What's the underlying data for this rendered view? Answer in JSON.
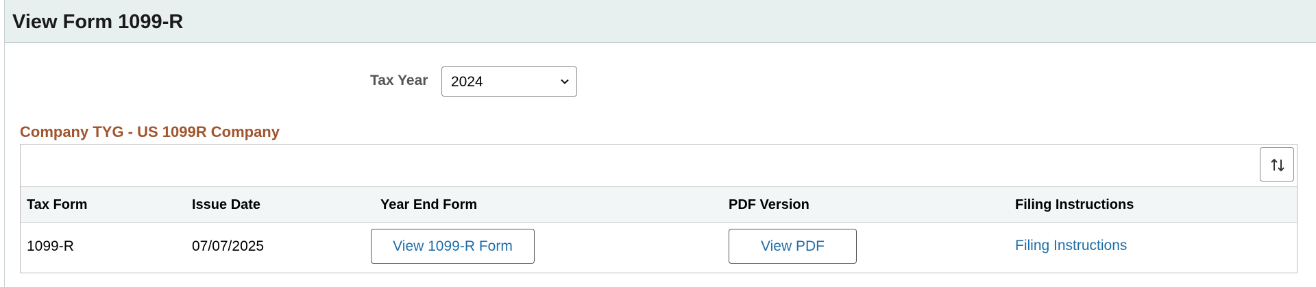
{
  "header": {
    "title": "View Form 1099-R"
  },
  "filters": {
    "tax_year_label": "Tax Year",
    "tax_year_selected": "2024"
  },
  "company": {
    "title": "Company TYG - US 1099R Company"
  },
  "grid": {
    "columns": [
      "Tax Form",
      "Issue Date",
      "Year End Form",
      "PDF Version",
      "Filing Instructions"
    ],
    "rows": [
      {
        "tax_form": "1099-R",
        "issue_date": "07/07/2025",
        "year_end_form_label": "View 1099-R Form",
        "pdf_label": "View PDF",
        "filing_instructions_label": "Filing Instructions"
      }
    ],
    "sort_icon": "sort-arrows-icon"
  },
  "colors": {
    "header_bg": "#e8f0ef",
    "company_title": "#a0552d",
    "link": "#1f6ea8",
    "grid_header_bg": "#f2f6f7"
  }
}
